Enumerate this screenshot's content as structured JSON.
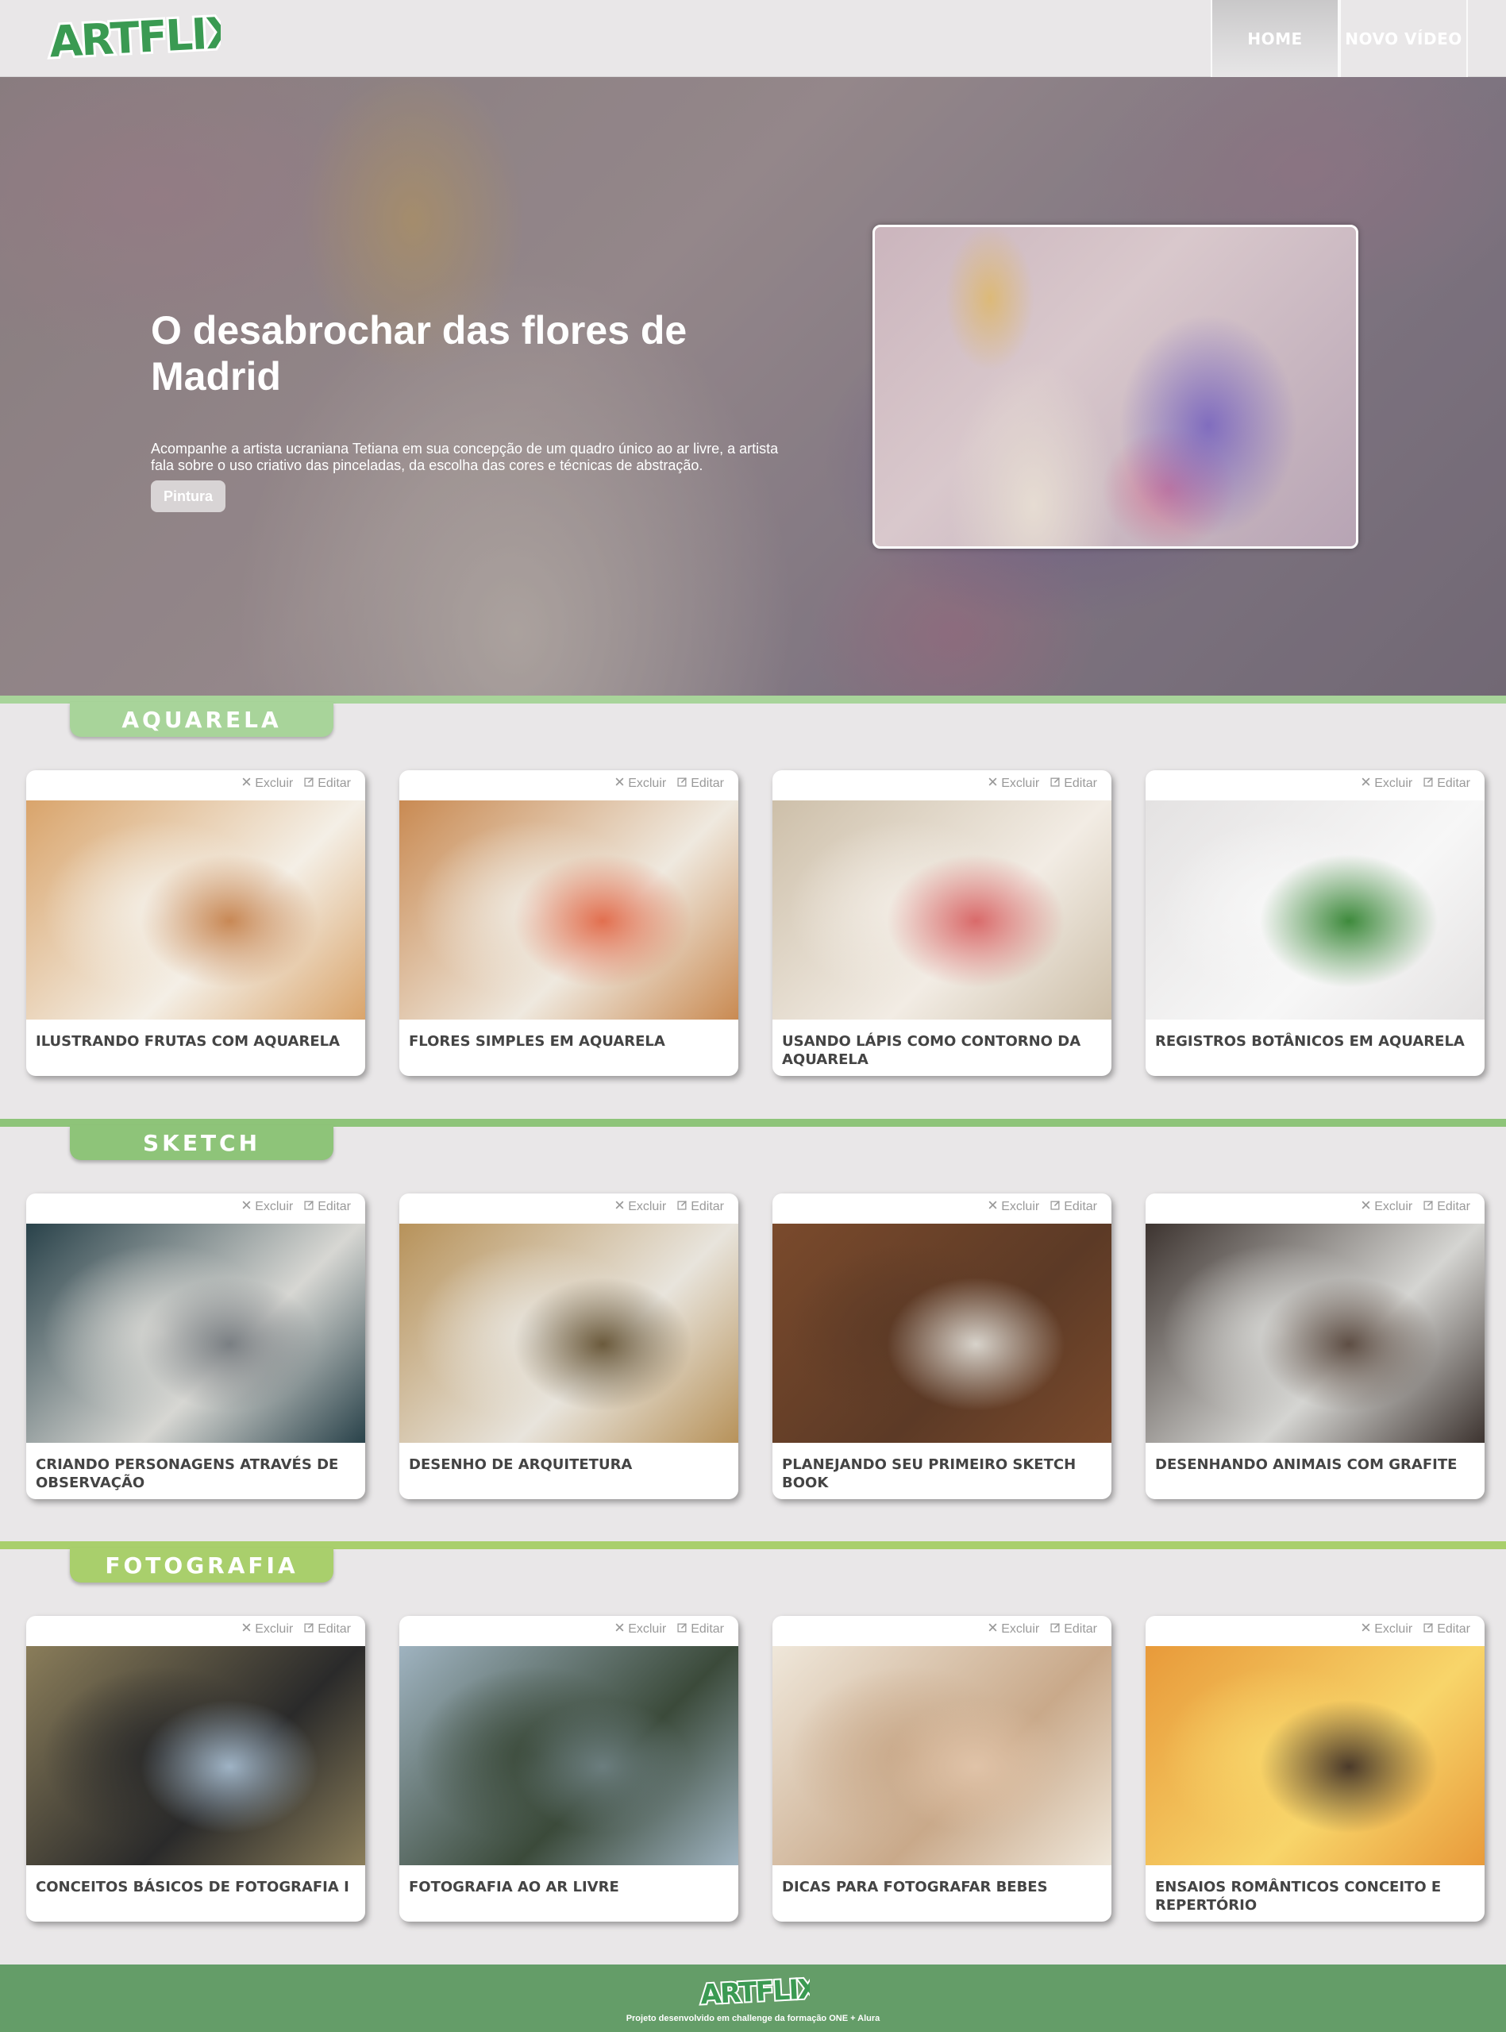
{
  "header": {
    "logo": "ARTFLIX",
    "nav": [
      {
        "label": "HOME",
        "active": true
      },
      {
        "label": "NOVO VÍDEO",
        "active": false
      }
    ]
  },
  "hero": {
    "title": "O desabrochar das flores de Madrid",
    "description": "Acompanhe a artista ucraniana Tetiana em sua concepção de um quadro único ao ar livre, a artista fala sobre o uso criativo das pinceladas, da escolha das cores e técnicas de abstração.",
    "tag": "Pintura"
  },
  "card_actions": {
    "delete": "Excluir",
    "edit": "Editar"
  },
  "sections": [
    {
      "name": "AQUARELA",
      "color": "#a8d49a",
      "cards": [
        {
          "title": "ILUSTRANDO FRUTAS COM AQUARELA"
        },
        {
          "title": "FLORES SIMPLES EM AQUARELA"
        },
        {
          "title": "USANDO LÁPIS COMO CONTORNO DA AQUARELA"
        },
        {
          "title": "REGISTROS BOTÂNICOS EM AQUARELA"
        }
      ]
    },
    {
      "name": "SKETCH",
      "color": "#8ec479",
      "cards": [
        {
          "title": "CRIANDO PERSONAGENS ATRAVÉS DE OBSERVAÇÃO"
        },
        {
          "title": "DESENHO DE ARQUITETURA"
        },
        {
          "title": "PLANEJANDO SEU PRIMEIRO SKETCH BOOK"
        },
        {
          "title": "DESENHANDO ANIMAIS COM GRAFITE"
        }
      ]
    },
    {
      "name": "FOTOGRAFIA",
      "color": "#a9cf6c",
      "cards": [
        {
          "title": "CONCEITOS BÁSICOS DE FOTOGRAFIA I"
        },
        {
          "title": "FOTOGRAFIA AO AR LIVRE"
        },
        {
          "title": "DICAS PARA FOTOGRAFAR BEBES"
        },
        {
          "title": "ENSAIOS ROMÂNTICOS CONCEITO E REPERTÓRIO"
        }
      ]
    }
  ],
  "footer": {
    "logo": "ARTFLIX",
    "text": "Projeto desenvolvido em challenge da formação ONE + Alura"
  },
  "colors": {
    "brand_green": "#3f9a55",
    "footer_bg": "#649d68",
    "page_bg": "#e9e7e8"
  }
}
